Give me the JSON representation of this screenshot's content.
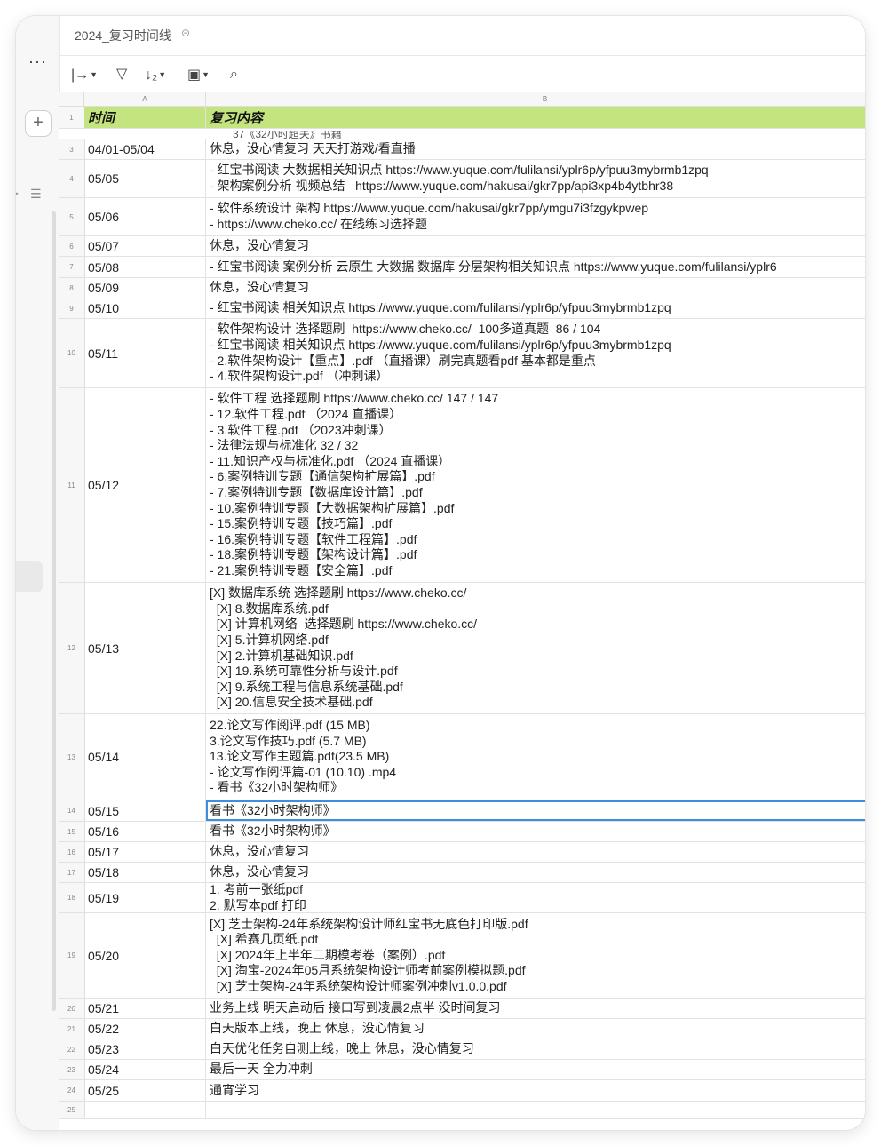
{
  "doc": {
    "title": "2024_复习时间线"
  },
  "toolbar": {
    "items": [
      "expand-icon",
      "filter-icon",
      "sort-icon",
      "freeze-icon",
      "find-icon"
    ]
  },
  "columns": {
    "a": "A",
    "b": "B"
  },
  "header_row": {
    "num": "1",
    "time": "时间",
    "content": "复习内容"
  },
  "partial_row_text": "37《32小时超关》书籍",
  "rows": [
    {
      "num": "3",
      "time": "04/01-05/04",
      "content": "休息，没心情复习 天天打游戏/看直播"
    },
    {
      "num": "4",
      "time": "05/05",
      "content": "- 红宝书阅读 大数据相关知识点 https://www.yuque.com/fulilansi/yplr6p/yfpuu3mybrmb1zpq\n- 架构案例分析 视频总结   https://www.yuque.com/hakusai/gkr7pp/api3xp4b4ytbhr38"
    },
    {
      "num": "5",
      "time": "05/06",
      "content": "- 软件系统设计 架构 https://www.yuque.com/hakusai/gkr7pp/ymgu7i3fzgykpwep\n- https://www.cheko.cc/ 在线练习选择题"
    },
    {
      "num": "6",
      "time": "05/07",
      "content": "休息，没心情复习"
    },
    {
      "num": "7",
      "time": "05/08",
      "content": "- 红宝书阅读 案例分析 云原生 大数据 数据库 分层架构相关知识点 https://www.yuque.com/fulilansi/yplr6"
    },
    {
      "num": "8",
      "time": "05/09",
      "content": "休息，没心情复习"
    },
    {
      "num": "9",
      "time": "05/10",
      "content": "- 红宝书阅读 相关知识点 https://www.yuque.com/fulilansi/yplr6p/yfpuu3mybrmb1zpq"
    },
    {
      "num": "10",
      "time": "05/11",
      "content": "- 软件架构设计 选择题刷  https://www.cheko.cc/  100多道真题  86 / 104\n- 红宝书阅读 相关知识点 https://www.yuque.com/fulilansi/yplr6p/yfpuu3mybrmb1zpq\n- 2.软件架构设计【重点】.pdf （直播课）刷完真题看pdf 基本都是重点\n- 4.软件架构设计.pdf （冲刺课）"
    },
    {
      "num": "11",
      "time": "05/12",
      "content": "- 软件工程 选择题刷 https://www.cheko.cc/ 147 / 147\n- 12.软件工程.pdf （2024 直播课）\n- 3.软件工程.pdf （2023冲刺课）\n- 法律法规与标准化 32 / 32\n- 11.知识产权与标准化.pdf （2024 直播课）\n- 6.案例特训专题【通信架构扩展篇】.pdf\n- 7.案例特训专题【数据库设计篇】.pdf\n- 10.案例特训专题【大数据架构扩展篇】.pdf\n- 15.案例特训专题【技巧篇】.pdf\n- 16.案例特训专题【软件工程篇】.pdf\n- 18.案例特训专题【架构设计篇】.pdf\n- 21.案例特训专题【安全篇】.pdf"
    },
    {
      "num": "12",
      "time": "05/13",
      "content": "[X] 数据库系统 选择题刷 https://www.cheko.cc/\n  [X] 8.数据库系统.pdf\n  [X] 计算机网络  选择题刷 https://www.cheko.cc/\n  [X] 5.计算机网络.pdf\n  [X] 2.计算机基础知识.pdf\n  [X] 19.系统可靠性分析与设计.pdf\n  [X] 9.系统工程与信息系统基础.pdf\n  [X] 20.信息安全技术基础.pdf"
    },
    {
      "num": "13",
      "time": "05/14",
      "content": "22.论文写作阅评.pdf (15 MB)\n3.论文写作技巧.pdf (5.7 MB)\n13.论文写作主题篇.pdf(23.5 MB)\n- 论文写作阅评篇-01 (10.10) .mp4\n- 看书《32小时架构师》"
    },
    {
      "num": "14",
      "time": "05/15",
      "content": "看书《32小时架构师》"
    },
    {
      "num": "15",
      "time": "05/16",
      "content": "看书《32小时架构师》"
    },
    {
      "num": "16",
      "time": "05/17",
      "content": "休息，没心情复习"
    },
    {
      "num": "17",
      "time": "05/18",
      "content": "休息，没心情复习"
    },
    {
      "num": "18",
      "time": "05/19",
      "content": "1. 考前一张纸pdf\n2. 默写本pdf 打印"
    },
    {
      "num": "19",
      "time": "05/20",
      "content": "[X] 芝士架构-24年系统架构设计师红宝书无底色打印版.pdf\n  [X] 希赛几页纸.pdf\n  [X] 2024年上半年二期模考卷（案例）.pdf\n  [X] 淘宝-2024年05月系统架构设计师考前案例模拟题.pdf\n  [X] 芝士架构-24年系统架构设计师案例冲刺v1.0.0.pdf"
    },
    {
      "num": "20",
      "time": "05/21",
      "content": "业务上线 明天启动后 接口写到凌晨2点半 没时间复习"
    },
    {
      "num": "21",
      "time": "05/22",
      "content": "白天版本上线，晚上 休息，没心情复习"
    },
    {
      "num": "22",
      "time": "05/23",
      "content": "白天优化任务自测上线，晚上 休息，没心情复习"
    },
    {
      "num": "23",
      "time": "05/24",
      "content": "最后一天 全力冲刺"
    },
    {
      "num": "24",
      "time": "05/25",
      "content": "通宵学习"
    },
    {
      "num": "25",
      "time": "",
      "content": ""
    }
  ]
}
